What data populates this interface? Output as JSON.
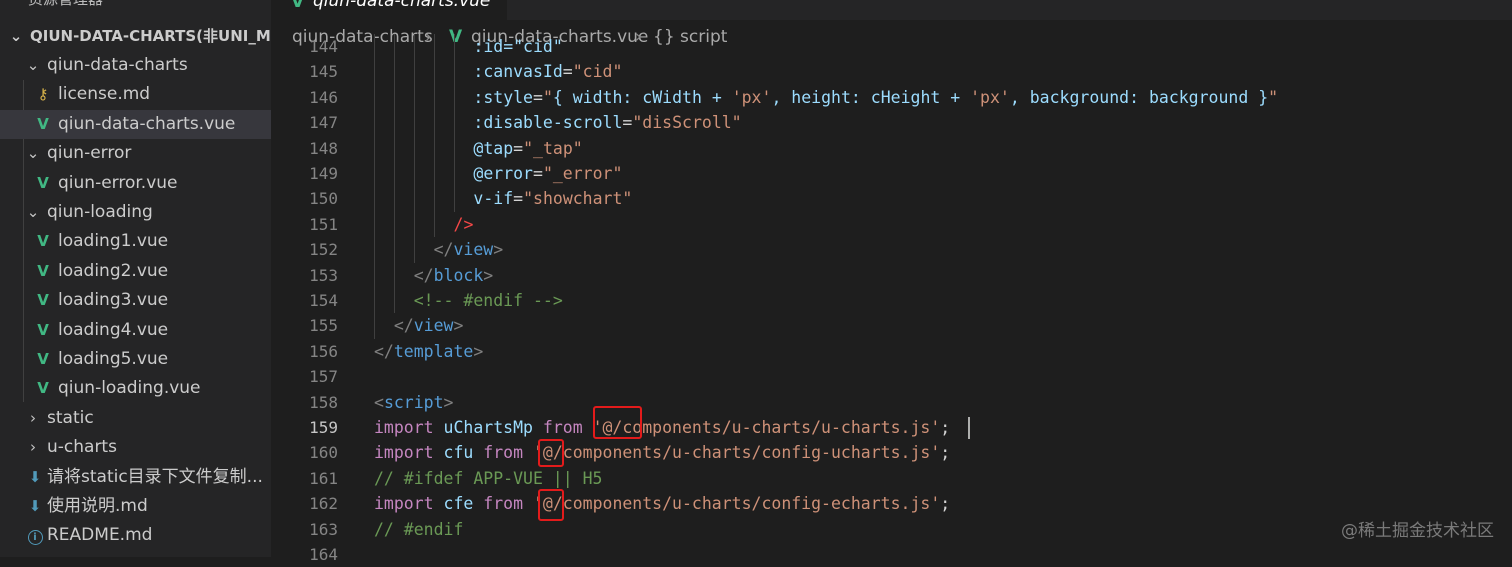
{
  "sidebar": {
    "title": "资源管理器",
    "project": "QIUN-DATA-CHARTS(非UNI_MO...",
    "tree": [
      {
        "label": "qiun-data-charts",
        "kind": "folder-open",
        "depth": 1
      },
      {
        "label": "license.md",
        "kind": "license",
        "depth": 2
      },
      {
        "label": "qiun-data-charts.vue",
        "kind": "vue",
        "depth": 2,
        "selected": true
      },
      {
        "label": "qiun-error",
        "kind": "folder-open",
        "depth": 1
      },
      {
        "label": "qiun-error.vue",
        "kind": "vue",
        "depth": 2
      },
      {
        "label": "qiun-loading",
        "kind": "folder-open",
        "depth": 1
      },
      {
        "label": "loading1.vue",
        "kind": "vue",
        "depth": 2
      },
      {
        "label": "loading2.vue",
        "kind": "vue",
        "depth": 2
      },
      {
        "label": "loading3.vue",
        "kind": "vue",
        "depth": 2
      },
      {
        "label": "loading4.vue",
        "kind": "vue",
        "depth": 2
      },
      {
        "label": "loading5.vue",
        "kind": "vue",
        "depth": 2
      },
      {
        "label": "qiun-loading.vue",
        "kind": "vue",
        "depth": 2
      },
      {
        "label": "static",
        "kind": "folder-closed",
        "depth": 1
      },
      {
        "label": "u-charts",
        "kind": "folder-closed",
        "depth": 1
      },
      {
        "label": "请将static目录下文件复制...",
        "kind": "download",
        "depth": 1
      },
      {
        "label": "使用说明.md",
        "kind": "download",
        "depth": 1
      },
      {
        "label": "README.md",
        "kind": "info",
        "depth": 1
      }
    ]
  },
  "editor": {
    "tab_label": "qiun-data-charts.vue",
    "breadcrumb": [
      "qiun-data-charts",
      "qiun-data-charts.vue",
      "{} script"
    ],
    "active_line": 159,
    "lines": [
      {
        "n": "144",
        "indent": 10,
        "tokens": [
          {
            "t": ":id=\"cid\"",
            "c": "t-attr"
          }
        ]
      },
      {
        "n": "145",
        "indent": 10,
        "tokens": [
          {
            "t": ":canvasId",
            "c": "t-attr"
          },
          {
            "t": "=",
            "c": "t-txt"
          },
          {
            "t": "\"cid\"",
            "c": "t-str"
          }
        ]
      },
      {
        "n": "146",
        "indent": 10,
        "tokens": [
          {
            "t": ":style",
            "c": "t-attr"
          },
          {
            "t": "=",
            "c": "t-txt"
          },
          {
            "t": "\"",
            "c": "t-str"
          },
          {
            "t": "{ width: cWidth + ",
            "c": "t-var"
          },
          {
            "t": "'px'",
            "c": "t-str"
          },
          {
            "t": ", height: cHeight + ",
            "c": "t-var"
          },
          {
            "t": "'px'",
            "c": "t-str"
          },
          {
            "t": ", background: background }",
            "c": "t-var"
          },
          {
            "t": "\"",
            "c": "t-str"
          }
        ]
      },
      {
        "n": "147",
        "indent": 10,
        "tokens": [
          {
            "t": ":disable-scroll",
            "c": "t-attr"
          },
          {
            "t": "=",
            "c": "t-txt"
          },
          {
            "t": "\"disScroll\"",
            "c": "t-str"
          }
        ]
      },
      {
        "n": "148",
        "indent": 10,
        "tokens": [
          {
            "t": "@tap",
            "c": "t-attr"
          },
          {
            "t": "=",
            "c": "t-txt"
          },
          {
            "t": "\"_tap\"",
            "c": "t-str"
          }
        ]
      },
      {
        "n": "149",
        "indent": 10,
        "tokens": [
          {
            "t": "@error",
            "c": "t-attr"
          },
          {
            "t": "=",
            "c": "t-txt"
          },
          {
            "t": "\"_error\"",
            "c": "t-str"
          }
        ]
      },
      {
        "n": "150",
        "indent": 10,
        "tokens": [
          {
            "t": "v-if",
            "c": "t-attr"
          },
          {
            "t": "=",
            "c": "t-txt"
          },
          {
            "t": "\"showchart\"",
            "c": "t-str"
          }
        ]
      },
      {
        "n": "151",
        "indent": 8,
        "tokens": [
          {
            "t": "/>",
            "c": "t-red"
          }
        ]
      },
      {
        "n": "152",
        "indent": 6,
        "tokens": [
          {
            "t": "</",
            "c": "t-punc"
          },
          {
            "t": "view",
            "c": "t-tag"
          },
          {
            "t": ">",
            "c": "t-punc"
          }
        ]
      },
      {
        "n": "153",
        "indent": 4,
        "tokens": [
          {
            "t": "</",
            "c": "t-punc"
          },
          {
            "t": "block",
            "c": "t-tag"
          },
          {
            "t": ">",
            "c": "t-punc"
          }
        ]
      },
      {
        "n": "154",
        "indent": 4,
        "tokens": [
          {
            "t": "<!-- #endif -->",
            "c": "t-cmt"
          }
        ]
      },
      {
        "n": "155",
        "indent": 2,
        "tokens": [
          {
            "t": "</",
            "c": "t-punc"
          },
          {
            "t": "view",
            "c": "t-tag"
          },
          {
            "t": ">",
            "c": "t-punc"
          }
        ]
      },
      {
        "n": "156",
        "indent": 0,
        "tokens": [
          {
            "t": "</",
            "c": "t-punc"
          },
          {
            "t": "template",
            "c": "t-tag"
          },
          {
            "t": ">",
            "c": "t-punc"
          }
        ]
      },
      {
        "n": "157",
        "indent": 0,
        "tokens": []
      },
      {
        "n": "158",
        "indent": 0,
        "tokens": [
          {
            "t": "<",
            "c": "t-punc"
          },
          {
            "t": "script",
            "c": "t-tag"
          },
          {
            "t": ">",
            "c": "t-punc"
          }
        ]
      },
      {
        "n": "159",
        "indent": 0,
        "tokens": [
          {
            "t": "import ",
            "c": "t-kw"
          },
          {
            "t": "uChartsMp",
            "c": "t-var"
          },
          {
            "t": " from ",
            "c": "t-kw"
          },
          {
            "t": "'@/components/u-charts/u-charts.js'",
            "c": "t-str"
          },
          {
            "t": ";",
            "c": "t-txt"
          }
        ]
      },
      {
        "n": "160",
        "indent": 0,
        "tokens": [
          {
            "t": "import ",
            "c": "t-kw"
          },
          {
            "t": "cfu",
            "c": "t-var"
          },
          {
            "t": " from ",
            "c": "t-kw"
          },
          {
            "t": "'@/components/u-charts/config-ucharts.js'",
            "c": "t-str"
          },
          {
            "t": ";",
            "c": "t-txt"
          }
        ]
      },
      {
        "n": "161",
        "indent": 0,
        "tokens": [
          {
            "t": "// #ifdef APP-VUE || H5",
            "c": "t-cmt"
          }
        ]
      },
      {
        "n": "162",
        "indent": 0,
        "tokens": [
          {
            "t": "import ",
            "c": "t-kw"
          },
          {
            "t": "cfe",
            "c": "t-var"
          },
          {
            "t": " from ",
            "c": "t-kw"
          },
          {
            "t": "'@/components/u-charts/config-echarts.js'",
            "c": "t-str"
          },
          {
            "t": ";",
            "c": "t-txt"
          }
        ]
      },
      {
        "n": "163",
        "indent": 0,
        "tokens": [
          {
            "t": "// #endif",
            "c": "t-cmt"
          }
        ]
      },
      {
        "n": "164",
        "indent": 0,
        "tokens": []
      }
    ]
  },
  "watermark": "@稀土掘金技术社区",
  "colors": {
    "annotation": "#e31b1b",
    "vue_green": "#41b883",
    "background": "#1e1e1e"
  }
}
